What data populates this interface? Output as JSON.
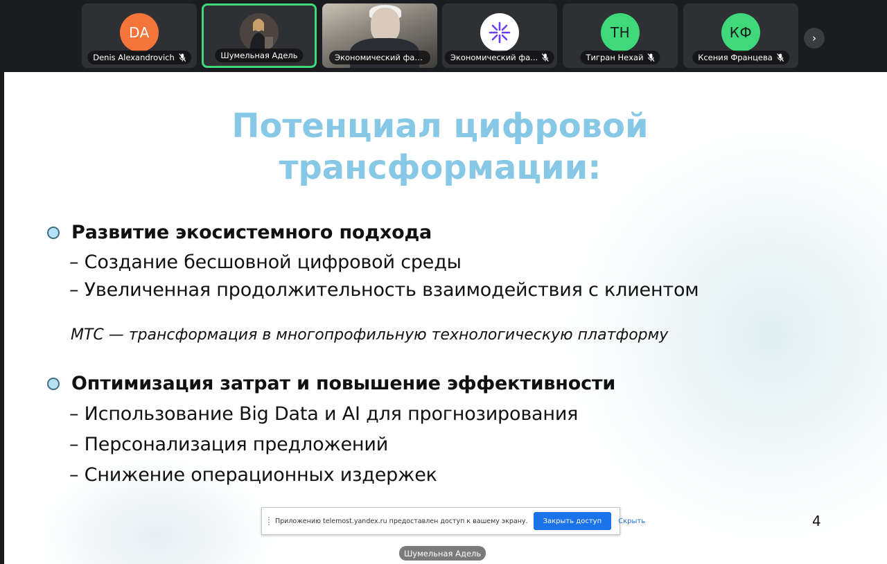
{
  "participants": [
    {
      "initials": "DA",
      "name": "Denis Alexandrovich",
      "color": "#f4743a",
      "muted": true,
      "type": "initials"
    },
    {
      "name": "Шумельная Адель",
      "muted": false,
      "type": "photo",
      "active": true
    },
    {
      "name": "Экономический факу...",
      "muted": false,
      "type": "video"
    },
    {
      "name": "Экономический фа...",
      "muted": true,
      "type": "logo",
      "icon": "snowflake-logo-icon"
    },
    {
      "initials": "ТН",
      "name": "Тигран Нехай",
      "color": "#3fd87a",
      "muted": true,
      "type": "initials"
    },
    {
      "initials": "КФ",
      "name": "Ксения Францева",
      "color": "#3fd87a",
      "muted": true,
      "type": "initials"
    }
  ],
  "strip": {
    "next_icon": "chevron-right-icon",
    "next_glyph": "›"
  },
  "slide": {
    "title_line1": "Потенциал цифровой",
    "title_line2": "трансформации:",
    "title_color": "#86c8e6",
    "bullets": [
      {
        "heading": "Развитие экосистемного подхода",
        "items": [
          "– Создание бесшовной цифровой среды",
          "– Увеличенная продолжительность взаимодействия с клиентом"
        ]
      },
      {
        "heading": "Оптимизация затрат и повышение эффективности",
        "items": [
          "– Использование Big Data и AI для прогнозирования",
          "– Персонализация предложений",
          "– Снижение операционных издержек"
        ]
      }
    ],
    "note": "МТС — трансформация в многопрофильную технологическую платформу",
    "page_number": "4"
  },
  "share_banner": {
    "message": "Приложению telemost.yandex.ru предоставлен доступ к вашему экрану.",
    "stop_label": "Закрыть доступ",
    "hide_label": "Скрыть"
  },
  "presenter": {
    "name": "Шумельная Адель"
  }
}
